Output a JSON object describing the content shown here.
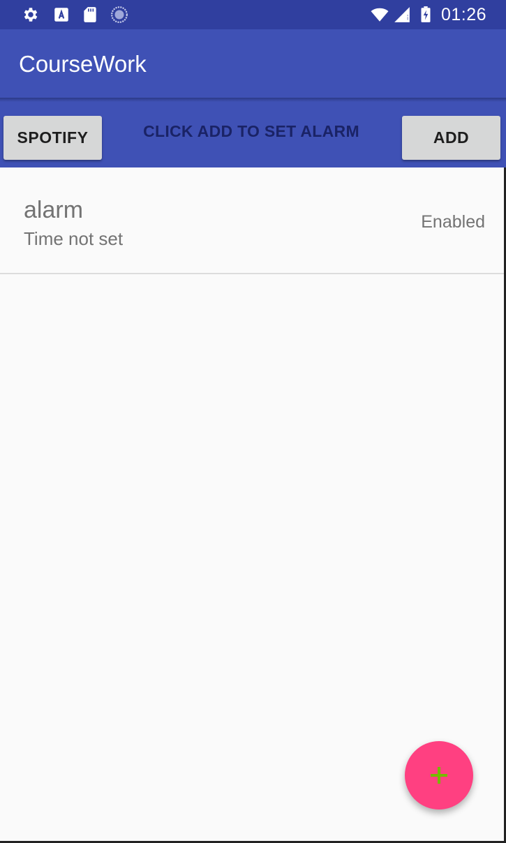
{
  "status_bar": {
    "time": "01:26",
    "left_icons": [
      "gear-icon",
      "a-box-icon",
      "sd-card-icon",
      "loading-icon"
    ],
    "right_icons": [
      "wifi-icon",
      "cell-signal-icon",
      "battery-charging-icon"
    ]
  },
  "app_bar": {
    "title": "CourseWork"
  },
  "toolbar": {
    "spotify_label": "SPOTIFY",
    "hint": "CLICK ADD TO SET ALARM",
    "add_label": "ADD"
  },
  "alarms": [
    {
      "title": "alarm",
      "subtitle": "Time not set",
      "status": "Enabled"
    }
  ],
  "fab": {
    "icon": "plus-icon"
  },
  "colors": {
    "primary_dark": "#303f9f",
    "primary": "#3f51b5",
    "accent": "#ff4081",
    "fab_icon": "#76b900"
  }
}
